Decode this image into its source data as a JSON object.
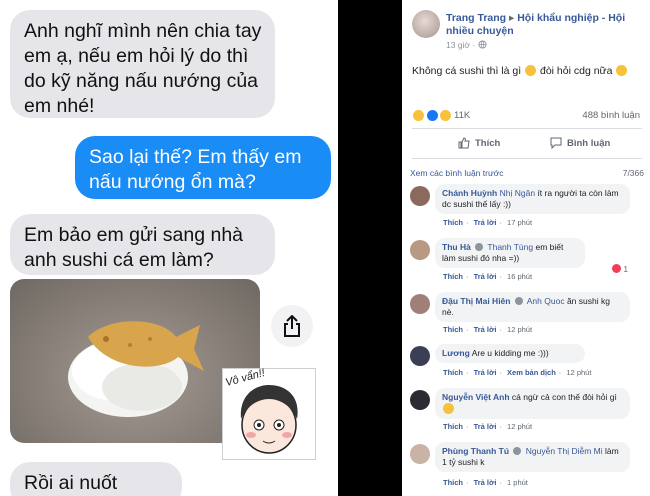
{
  "chat": {
    "msg1": "Anh nghĩ mình nên chia tay em ạ, nếu em hỏi lý do thì do kỹ năng nấu nướng của em nhé!",
    "msg2": "Sao lại thế? Em thấy em nấu nướng ổn mà?",
    "msg3": "Em bảo em gửi sang nhà anh sushi cá em làm?",
    "msg4": "Rồi ai nuốt được?",
    "sticker_text": "Vô vẩn!!"
  },
  "post": {
    "author": "Trang Trang",
    "separator": "▸",
    "group": "Hội khẩu nghiệp - Hội nhiều chuyện",
    "time": "13 giờ ·",
    "text": "Không cá sushi thì là gì",
    "text_tail": "đòi hỏi cdg nữa",
    "reaction_count": "11K",
    "comment_count": "488 bình luận",
    "like_label": "Thích",
    "comment_label": "Bình luận",
    "prev_link": "Xem các bình luận trước",
    "prev_count": "7/366"
  },
  "comments": [
    {
      "name": "Chánh Huỳnh",
      "tag": "Nhị Ngân",
      "text": "ít ra người ta còn làm dc sushi thế lấy :))",
      "like": "Thích",
      "reply": "Trả lời",
      "time": "17 phút"
    },
    {
      "name": "Thu Hà",
      "tag": "Thanh Tùng",
      "text": "em biết làm sushi đó nha =))",
      "like": "Thích",
      "reply": "Trả lời",
      "time": "16 phút",
      "heart": "1"
    },
    {
      "name": "Đậu Thị Mai Hiên",
      "tag": "Anh Quoc",
      "text": "ăn sushi kg nè.",
      "like": "Thích",
      "reply": "Trả lời",
      "time": "12 phút"
    },
    {
      "name": "Lương",
      "tag": "",
      "text": "Are u kidding me :)))",
      "like": "Thích",
      "reply": "Trả lời",
      "extra": "Xem bản dịch",
      "time": "12 phút"
    },
    {
      "name": "Nguyễn Việt Anh",
      "tag": "",
      "text": "cá ngừ cả con thế đòi hỏi gì",
      "like": "Thích",
      "reply": "Trả lời",
      "time": "12 phút"
    },
    {
      "name": "Phùng Thanh Tú",
      "tag": "Nguyễn Thị Diễm Mi",
      "text": "làm 1 tỷ sushi k",
      "like": "Thích",
      "reply": "Trả lời",
      "time": "1 phút"
    }
  ],
  "colors": {
    "sent_bubble": "#1a8cf5",
    "received_bubble": "#e6e6ea",
    "fb_link": "#385898"
  },
  "icons": [
    "share-icon",
    "globe-icon",
    "like-thumb-icon",
    "comment-icon",
    "heart-icon"
  ]
}
